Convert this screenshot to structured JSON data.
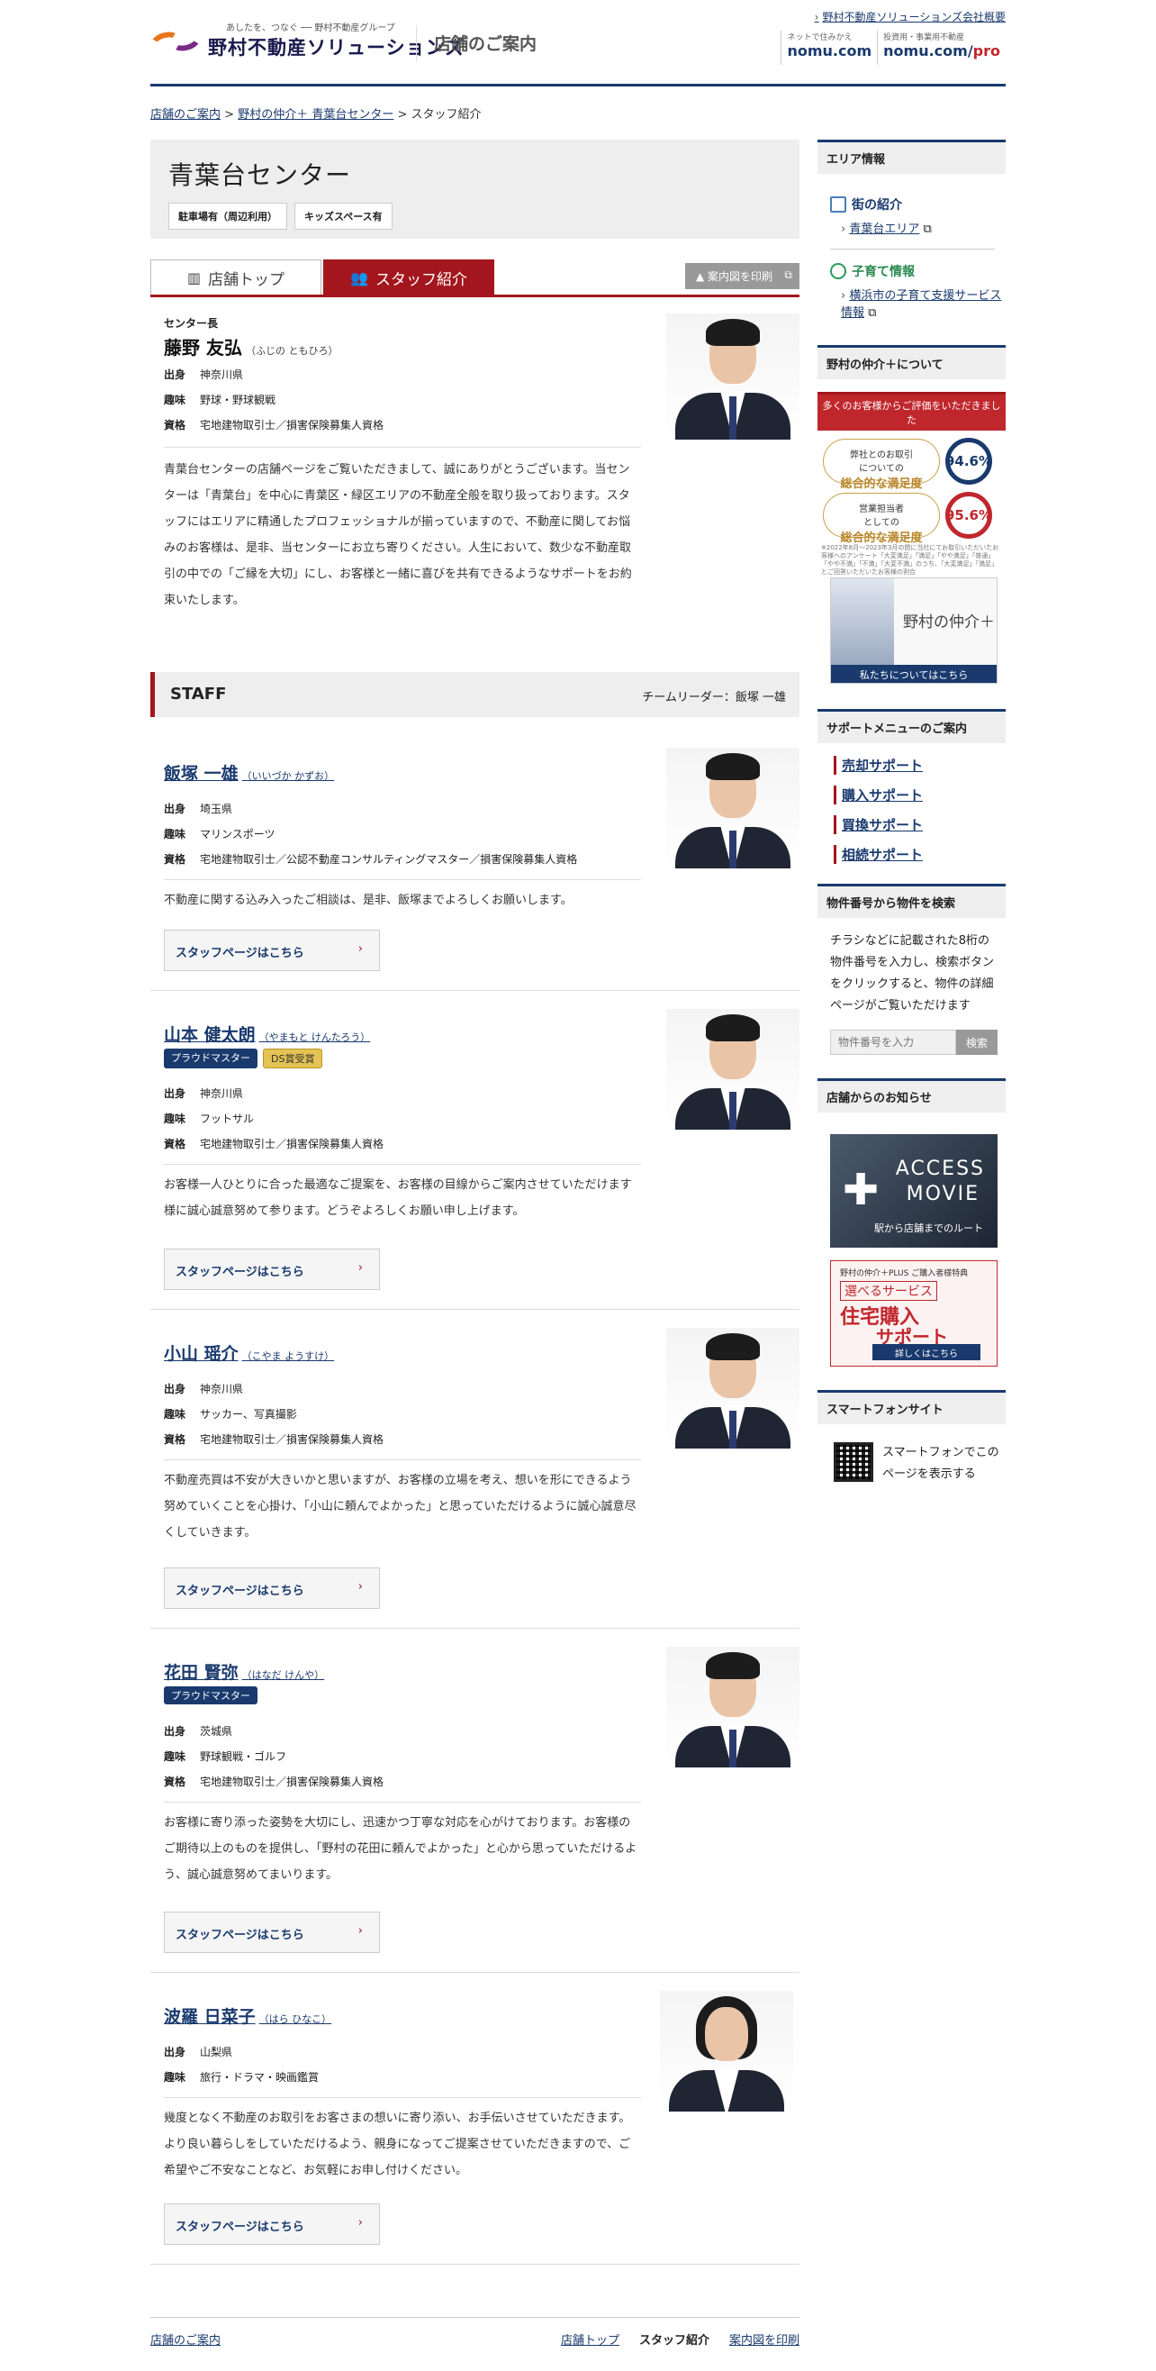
{
  "header": {
    "tagline": "あしたを、つなぐ ── 野村不動産グループ",
    "brand": "野村不動産ソリューションズ",
    "section_title": "店舗のご案内",
    "corp_link": "野村不動産ソリューションズ会社概要",
    "site1_small": "ネットで住みかえ",
    "site1_big": "nomu.com",
    "site2_small": "投資用・事業用不動産",
    "site2_big": "nomu.com/",
    "site2_pro": "pro"
  },
  "breadcrumb": {
    "home": "店舗のご案内",
    "store": "野村の仲介＋ 青葉台センター",
    "sep": ">",
    "current": "スタッフ紹介"
  },
  "store": {
    "name": "青葉台センター",
    "tags": [
      "駐車場有（周辺利用）",
      "キッズスペース有"
    ]
  },
  "tabs": {
    "top": "店舗トップ",
    "staff": "スタッフ紹介",
    "print": "案内図を印刷"
  },
  "manager": {
    "role": "センター長",
    "name": "藤野 友弘",
    "kana": "（ふじの ともひろ）",
    "labels": {
      "origin": "出身",
      "hobby": "趣味",
      "qual": "資格"
    },
    "origin": "神奈川県",
    "hobby": "野球・野球観戦",
    "qual": "宅地建物取引士／損害保険募集人資格",
    "desc": "青葉台センターの店舗ページをご覧いただきまして、誠にありがとうございます。当センターは「青葉台」を中心に青葉区・緑区エリアの不動産全般を取り扱っております。スタッフにはエリアに精通したプロフェッショナルが揃っていますので、不動産に関してお悩みのお客様は、是非、当センターにお立ち寄りください。人生において、数少な不動産取引の中での「ご縁を大切」にし、お客様と一緒に喜びを共有できるようなサポートをお約束いたします。"
  },
  "staff_section": {
    "title": "STAFF",
    "leader": "チームリーダー：飯塚 一雄",
    "button_label": "スタッフページはこちら",
    "labels": {
      "origin": "出身",
      "hobby": "趣味",
      "qual": "資格"
    },
    "members": [
      {
        "name": "飯塚 一雄",
        "kana": "（いいづか かずお）",
        "badges": [],
        "origin": "埼玉県",
        "hobby": "マリンスポーツ",
        "qual": "宅地建物取引士／公認不動産コンサルティングマスター／損害保険募集人資格",
        "desc": "不動産に関する込み入ったご相談は、是非、飯塚までよろしくお願いします。"
      },
      {
        "name": "山本 健太朗",
        "kana": "（やまもと けんたろう）",
        "badges": [
          "プラウドマスター",
          "DS賞受賞"
        ],
        "origin": "神奈川県",
        "hobby": "フットサル",
        "qual": "宅地建物取引士／損害保険募集人資格",
        "desc": "お客様一人ひとりに合った最適なご提案を、お客様の目線からご案内させていただけます様に誠心誠意努めて参ります。どうぞよろしくお願い申し上げます。"
      },
      {
        "name": "小山 瑶介",
        "kana": "（こやま ようすけ）",
        "badges": [],
        "origin": "神奈川県",
        "hobby": "サッカー、写真撮影",
        "qual": "宅地建物取引士／損害保険募集人資格",
        "desc": "不動産売買は不安が大きいかと思いますが、お客様の立場を考え、想いを形にできるよう努めていくことを心掛け、「小山に頼んでよかった」と思っていただけるように誠心誠意尽くしていきます。"
      },
      {
        "name": "花田 賢弥",
        "kana": "（はなだ けんや）",
        "badges": [
          "プラウドマスター"
        ],
        "origin": "茨城県",
        "hobby": "野球観戦・ゴルフ",
        "qual": "宅地建物取引士／損害保険募集人資格",
        "desc": "お客様に寄り添った姿勢を大切にし、迅速かつ丁寧な対応を心がけております。お客様のご期待以上のものを提供し、「野村の花田に頼んでよかった」と心から思っていただけるよう、誠心誠意努めてまいります。"
      },
      {
        "name": "波羅 日菜子",
        "kana": "（はら ひなこ）",
        "badges": [],
        "origin": "山梨県",
        "hobby": "旅行・ドラマ・映画鑑賞",
        "qual": "",
        "desc": "幾度となく不動産のお取引をお客さまの想いに寄り添い、お手伝いさせていただきます。より良い暮らしをしていただけるよう、親身になってご提案させていただきますので、ご希望やご不安なことなど、お気軽にお申し付けください。"
      }
    ]
  },
  "footer_nav": {
    "home": "店舗のご案内",
    "top": "店舗トップ",
    "staff": "スタッフ紹介",
    "print": "案内図を印刷"
  },
  "sidebar": {
    "area_title": "エリア情報",
    "town_intro": "街の紹介",
    "town_link": "青葉台エリア",
    "child_title": "子育て情報",
    "child_link": "横浜市の子育て支援サービス情報",
    "about_title": "野村の仲介＋について",
    "eval_top": "多くのお客様からご評価をいただきました",
    "eval1_pre": "弊社とのお取引",
    "eval1_mid": "についての",
    "eval1_big": "総合的な満足度",
    "eval1_value": "94.6%",
    "eval2_pre": "営業担当者",
    "eval2_mid": "としての",
    "eval2_big": "総合的な満足度",
    "eval2_value": "95.6%",
    "eval_note": "※2022年8月〜2023年3月の間に当社にてお取引いただいたお客様へのアンケート「大変満足」「満足」「やや満足」「普通」「やや不満」「不満」「大変不満」のうち、「大変満足」「満足」とご回答いただいたお客様の割合",
    "about_banner_text": "野村の仲介＋",
    "about_banner_bar": "私たちについてはこちら",
    "support_title": "サポートメニューのご案内",
    "support_items": [
      "売却サポート",
      "購入サポート",
      "買換サポート",
      "相続サポート"
    ],
    "prop_title": "物件番号から物件を検索",
    "prop_desc": "チラシなどに記載された8桁の物件番号を入力し、検索ボタンをクリックすると、物件の詳細ページがご覧いただけます",
    "prop_placeholder": "物件番号を入力",
    "prop_button": "検索",
    "news_title": "店舗からのお知らせ",
    "movie_line1": "ACCESS",
    "movie_line2": "MOVIE",
    "movie_sub": "駅から店舗までのルート",
    "house_pre": "野村の仲介＋PLUS ご購入者様特典",
    "house_select": "選べるサービス",
    "house_main": "住宅購入",
    "house_sub": "サポート",
    "house_bar": "詳しくはこちら",
    "phone_title": "スマートフォンサイト",
    "phone_text": "スマートフォンでこのページを表示する"
  }
}
